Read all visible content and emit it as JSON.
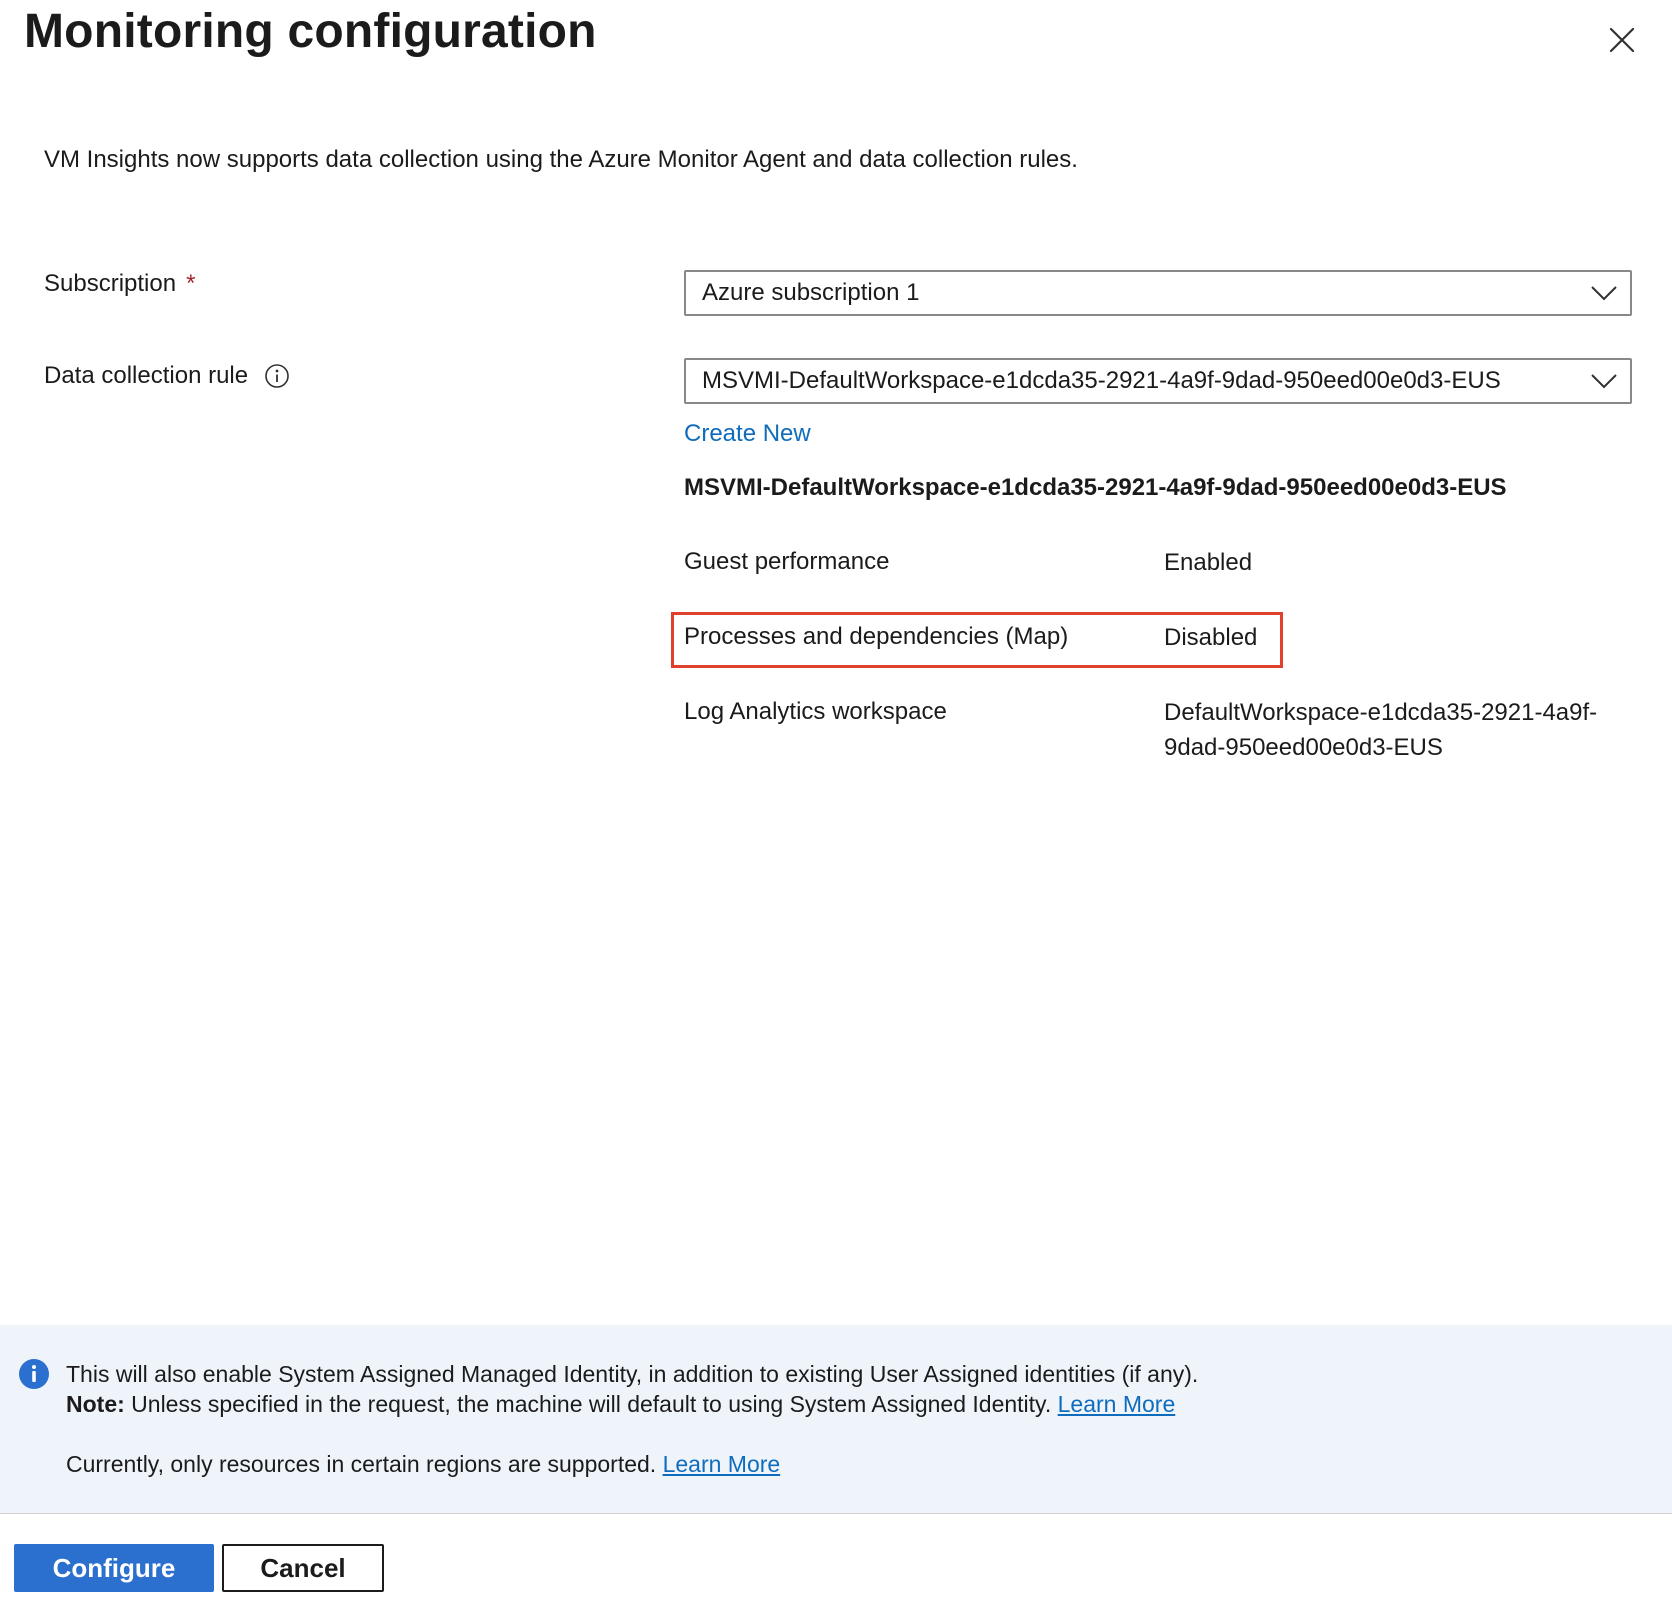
{
  "panel": {
    "title": "Monitoring configuration",
    "intro": "VM Insights now supports data collection using the Azure Monitor Agent and data collection rules."
  },
  "form": {
    "subscription": {
      "label": "Subscription",
      "required_mark": "*",
      "value": "Azure subscription 1"
    },
    "dcr": {
      "label": "Data collection rule",
      "value": "MSVMI-DefaultWorkspace-e1dcda35-2921-4a9f-9dad-950eed00e0d3-EUS",
      "create_new": "Create New"
    }
  },
  "rule_details": {
    "name": "MSVMI-DefaultWorkspace-e1dcda35-2921-4a9f-9dad-950eed00e0d3-EUS",
    "properties": [
      {
        "key": "Guest performance",
        "value": "Enabled"
      },
      {
        "key": "Processes and dependencies (Map)",
        "value": "Disabled"
      },
      {
        "key": "Log Analytics workspace",
        "value_line1": "DefaultWorkspace-e1dcda35-2921-4a9f-",
        "value_line2": "9dad-950eed00e0d3-EUS"
      }
    ]
  },
  "banner": {
    "line1": "This will also enable System Assigned Managed Identity, in addition to existing User Assigned identities (if any).",
    "note_label": "Note:",
    "note_text": " Unless specified in the request, the machine will default to using System Assigned Identity. ",
    "learn_more_1": "Learn More",
    "regions_text": "Currently, only resources in certain regions are supported. ",
    "learn_more_2": "Learn More"
  },
  "footer": {
    "configure_label": "Configure",
    "cancel_label": "Cancel"
  },
  "colors": {
    "accent": "#2b6fcf",
    "link": "#0f6cbd",
    "highlight": "#e0412e",
    "banner_bg": "#eff4fb",
    "required": "#a4262c"
  },
  "icons": {
    "close": "close-icon",
    "info": "info-icon",
    "chevron": "chevron-down-icon"
  }
}
